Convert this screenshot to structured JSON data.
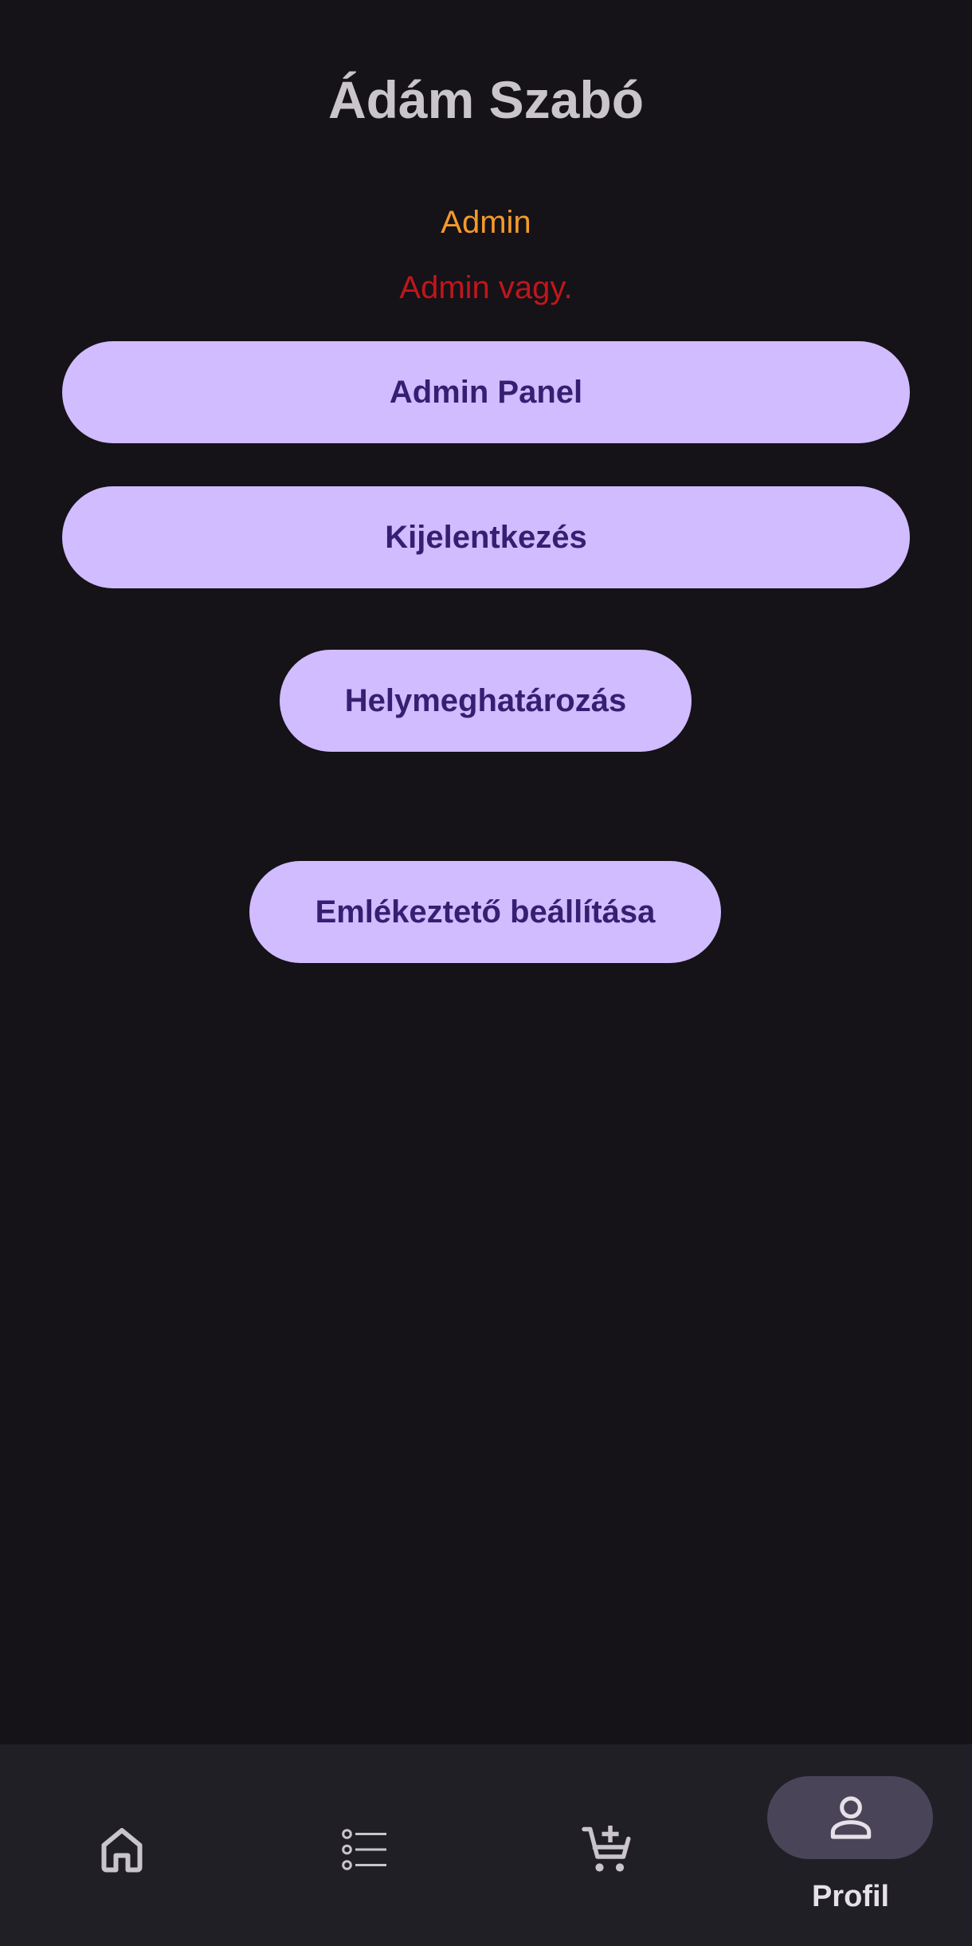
{
  "profile": {
    "name": "Ádám Szabó",
    "role": "Admin",
    "admin_message": "Admin vagy."
  },
  "buttons": {
    "admin_panel": "Admin Panel",
    "logout": "Kijelentkezés",
    "location": "Helymeghatározás",
    "reminder": "Emlékeztető beállítása"
  },
  "bottom_nav": {
    "items": [
      {
        "icon": "home-icon",
        "label": ""
      },
      {
        "icon": "list-icon",
        "label": ""
      },
      {
        "icon": "add-to-cart-icon",
        "label": ""
      },
      {
        "icon": "person-icon",
        "label": "Profil",
        "selected": true
      }
    ]
  },
  "colors": {
    "background": "#151218",
    "button_bg": "#d0bcff",
    "button_text": "#381e72",
    "role_color": "#f39a2c",
    "admin_message_color": "#c0161b",
    "navbar_bg": "#211f26",
    "selected_indicator": "#4a4458"
  }
}
